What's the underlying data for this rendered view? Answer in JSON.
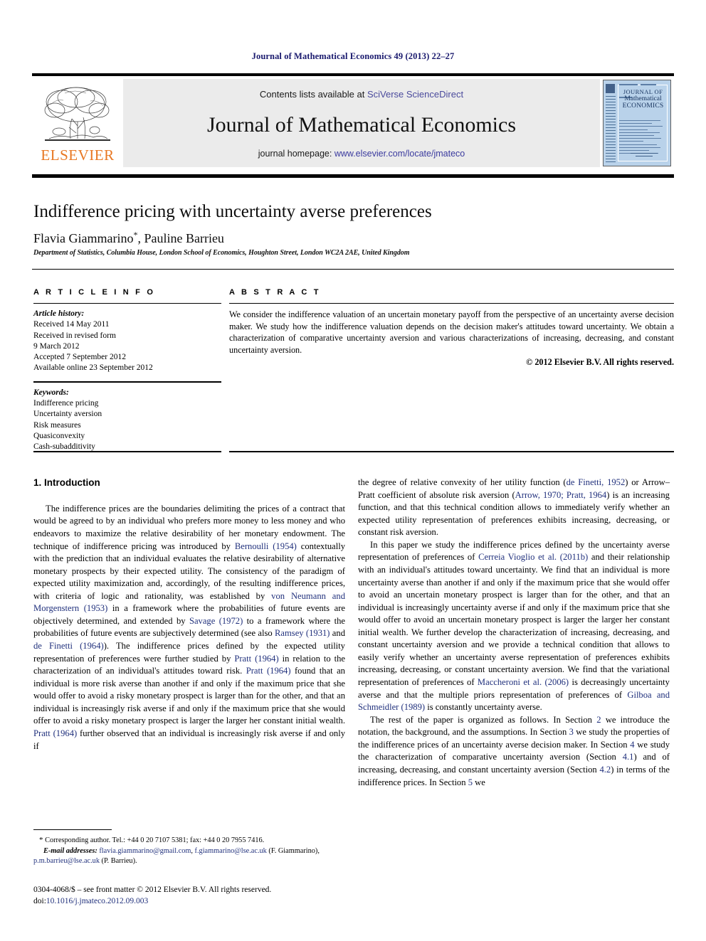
{
  "running_head": "Journal of Mathematical Economics 49 (2013) 22–27",
  "masthead": {
    "publisher_name": "ELSEVIER",
    "contents_prefix": "Contents lists available at ",
    "contents_link": "SciVerse ScienceDirect",
    "journal_name": "Journal of Mathematical Economics",
    "homepage_prefix": "journal homepage: ",
    "homepage_url": "www.elsevier.com/locate/jmateco",
    "cover": {
      "line1": "JOURNAL OF",
      "line2": "Mathematical",
      "line3": "ECONOMICS"
    },
    "accent_color": "#E87722",
    "link_color": "#3a3a9e",
    "cover_color": "#b9d2ea"
  },
  "article": {
    "title": "Indifference pricing with uncertainty averse preferences",
    "authors": "Flavia Giammarino",
    "authors_star": "*",
    "authors_rest": ", Pauline Barrieu",
    "affiliation": "Department of Statistics, Columbia House, London School of Economics, Houghton Street, London WC2A 2AE, United Kingdom"
  },
  "article_info": {
    "heading": "A R T I C L E    I N F O",
    "history_label": "Article history:",
    "history": [
      "Received 14 May 2011",
      "Received in revised form",
      "9 March 2012",
      "Accepted 7 September 2012",
      "Available online 23 September 2012"
    ],
    "keywords_label": "Keywords:",
    "keywords": [
      "Indifference pricing",
      "Uncertainty aversion",
      "Risk measures",
      "Quasiconvexity",
      "Cash-subadditivity"
    ]
  },
  "abstract": {
    "heading": "A B S T R A C T",
    "text": "We consider the indifference valuation of an uncertain monetary payoff from the perspective of an uncertainty averse decision maker. We study how the indifference valuation depends on the decision maker's attitudes toward uncertainty. We obtain a characterization of comparative uncertainty aversion and various characterizations of increasing, decreasing, and constant uncertainty aversion.",
    "copyright": "© 2012 Elsevier B.V. All rights reserved."
  },
  "body": {
    "section_heading": "1. Introduction",
    "left_paragraph_1": "The indifference prices are the boundaries delimiting the prices of a contract that would be agreed to by an individual who prefers more money to less money and who endeavors to maximize the relative desirability of her monetary endowment. The technique of indifference pricing was introduced by Bernoulli (1954) contextually with the prediction that an individual evaluates the relative desirability of alternative monetary prospects by their expected utility. The consistency of the paradigm of expected utility maximization and, accordingly, of the resulting indifference prices, with criteria of logic and rationality, was established by von Neumann and Morgenstern (1953) in a framework where the probabilities of future events are objectively determined, and extended by Savage (1972) to a framework where the probabilities of future events are subjectively determined (see also Ramsey (1931) and de Finetti (1964)). The indifference prices defined by the expected utility representation of preferences were further studied by Pratt (1964) in relation to the characterization of an individual's attitudes toward risk. Pratt (1964) found that an individual is more risk averse than another if and only if the maximum price that she would offer to avoid a risky monetary prospect is larger than for the other, and that an individual is increasingly risk averse if and only if the maximum price that she would offer to avoid a risky monetary prospect is larger the larger her constant initial wealth. Pratt (1964) further observed that an individual is increasingly risk averse if and only if",
    "right_paragraph_1": "the degree of relative convexity of her utility function (de Finetti, 1952) or Arrow–Pratt coefficient of absolute risk aversion (Arrow, 1970; Pratt, 1964) is an increasing function, and that this technical condition allows to immediately verify whether an expected utility representation of preferences exhibits increasing, decreasing, or constant risk aversion.",
    "right_paragraph_2": "In this paper we study the indifference prices defined by the uncertainty averse representation of preferences of Cerreia Vioglio et al. (2011b) and their relationship with an individual's attitudes toward uncertainty. We find that an individual is more uncertainty averse than another if and only if the maximum price that she would offer to avoid an uncertain monetary prospect is larger than for the other, and that an individual is increasingly uncertainty averse if and only if the maximum price that she would offer to avoid an uncertain monetary prospect is larger the larger her constant initial wealth. We further develop the characterization of increasing, decreasing, and constant uncertainty aversion and we provide a technical condition that allows to easily verify whether an uncertainty averse representation of preferences exhibits increasing, decreasing, or constant uncertainty aversion. We find that the variational representation of preferences of Maccheroni et al. (2006) is decreasingly uncertainty averse and that the multiple priors representation of preferences of Gilboa and Schmeidler (1989) is constantly uncertainty averse.",
    "right_paragraph_3": "The rest of the paper is organized as follows. In Section 2 we introduce the notation, the background, and the assumptions. In Section 3 we study the properties of the indifference prices of an uncertainty averse decision maker. In Section 4 we study the characterization of comparative uncertainty aversion (Section 4.1) and of increasing, decreasing, and constant uncertainty aversion (Section 4.2) in terms of the indifference prices. In Section 5 we"
  },
  "footnote": {
    "star": "*",
    "corresponding": "Corresponding author. Tel.: +44 0 20 7107 5381; fax: +44 0 20 7955 7416.",
    "email_label": "E-mail addresses:",
    "email1": "flavia.giammarino@gmail.com",
    "email_sep1": ", ",
    "email2": "f.giammarino@lse.ac.uk",
    "email_owner1": " (F. Giammarino), ",
    "email3": "p.m.barrieu@lse.ac.uk",
    "email_owner2": " (P. Barrieu)."
  },
  "imprint": {
    "line1": "0304-4068/$ – see front matter © 2012 Elsevier B.V. All rights reserved.",
    "doi_prefix": "doi:",
    "doi": "10.1016/j.jmateco.2012.09.003"
  }
}
